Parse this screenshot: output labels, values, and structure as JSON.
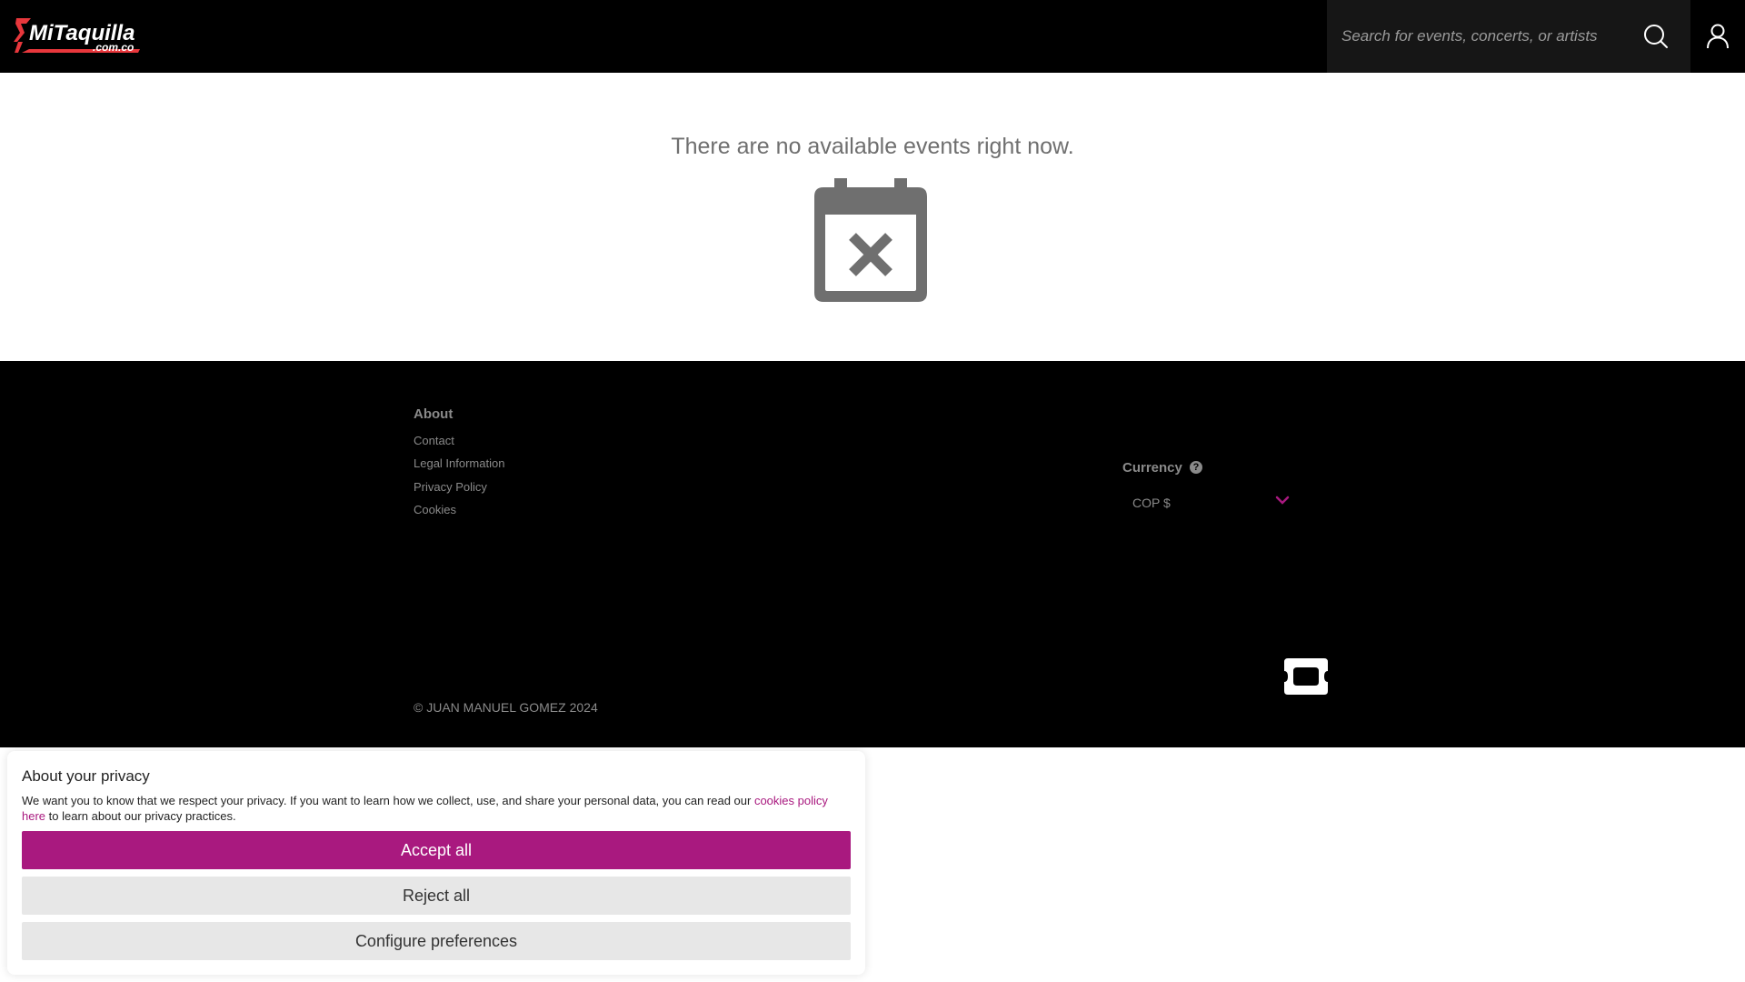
{
  "header": {
    "logo_text": "MiTaquilla",
    "logo_sub": ".com.co",
    "search_placeholder": "Search for events, concerts, or artists",
    "search_icon": "search-icon",
    "user_icon": "user-icon"
  },
  "main": {
    "empty_message": "There are no available events right now.",
    "empty_icon": "calendar-x-icon"
  },
  "footer": {
    "about_heading": "About",
    "links": [
      "Contact",
      "Legal Information",
      "Privacy Policy",
      "Cookies"
    ],
    "currency_label": "Currency",
    "currency_help_icon": "question-icon",
    "currency_value": "COP $",
    "copyright": "© JUAN MANUEL GOMEZ 2024",
    "ticket_icon": "ticket-icon"
  },
  "cookie": {
    "title": "About your privacy",
    "text_before": "We want you to know that we respect your privacy. If you want to learn how we collect, use, and share your personal data, you can read our ",
    "link_text": "cookies policy here",
    "text_after": " to learn about our privacy practices.",
    "accept_label": "Accept all",
    "reject_label": "Reject all",
    "configure_label": "Configure preferences"
  },
  "colors": {
    "brand_accent": "#a9197f",
    "header_bg": "#000000",
    "logo_red": "#e8373c",
    "muted_text": "#8a8a8a",
    "empty_icon": "#6f6f6f"
  }
}
